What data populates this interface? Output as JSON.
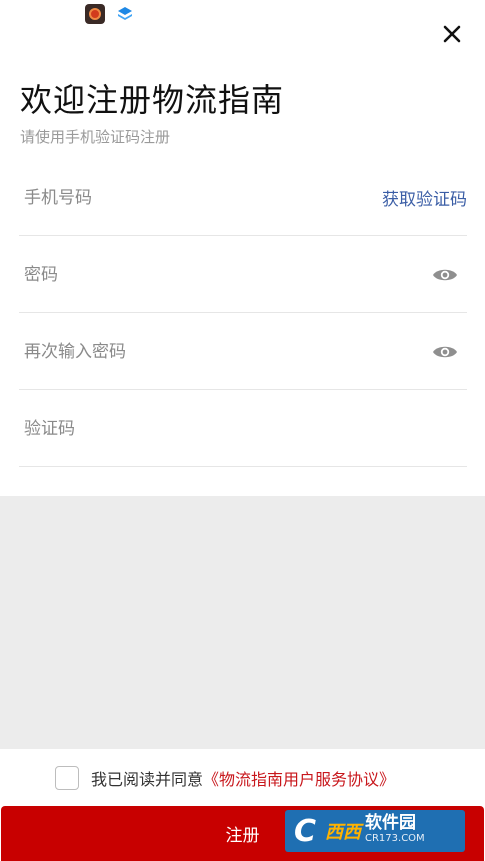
{
  "header": {
    "close_icon": "close-icon",
    "title": "欢迎注册物流指南",
    "subtitle": "请使用手机验证码注册"
  },
  "form": {
    "phone_placeholder": "手机号码",
    "get_code_label": "获取验证码",
    "password_placeholder": "密码",
    "confirm_password_placeholder": "再次输入密码",
    "verification_placeholder": "验证码",
    "eye_icon": "eye-icon"
  },
  "agreement": {
    "checked": false,
    "text": "我已阅读并同意",
    "link": "《物流指南用户服务协议》"
  },
  "register_button_label": "注册",
  "watermark": {
    "brand": "西西",
    "name": "软件园",
    "site": "CR173.COM"
  },
  "colors": {
    "accent_red": "#c80000",
    "link_red": "#c8171c",
    "link_blue": "#3b5ea6",
    "gray_area": "#ececec"
  }
}
